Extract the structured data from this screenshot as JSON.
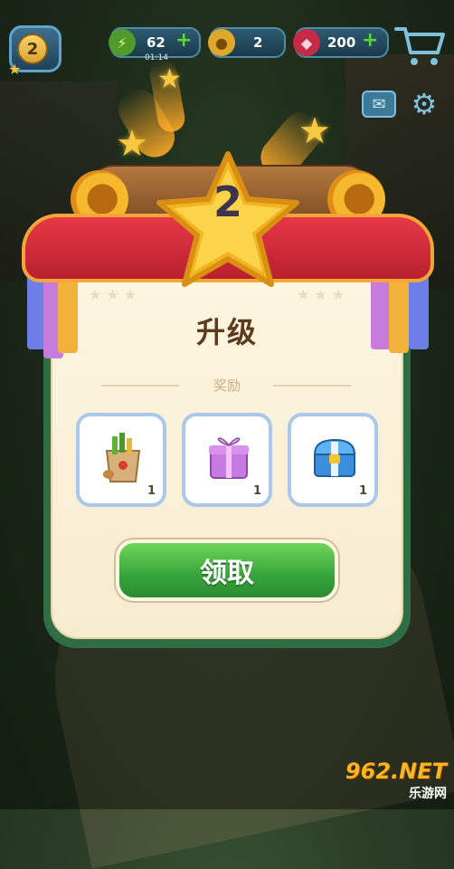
{
  "hud": {
    "level": "2",
    "energy": "62",
    "energy_timer": "01:14",
    "coins": "2",
    "gems": "200",
    "icons": {
      "energy": "lightning-icon",
      "coins": "coin-icon",
      "gems": "ruby-icon",
      "shop": "shopping-cart-icon",
      "mail": "mail-icon",
      "settings": "gear-icon"
    }
  },
  "dialog": {
    "level_number": "2",
    "title": "升级",
    "reward_label": "奖励",
    "rewards": [
      {
        "icon": "grocery-bag-icon",
        "count": "1"
      },
      {
        "icon": "gift-box-icon",
        "count": "1"
      },
      {
        "icon": "treasure-chest-icon",
        "count": "1"
      }
    ],
    "claim_label": "领取"
  },
  "watermark": {
    "text": "962.NET",
    "subtext": "乐游网"
  },
  "colors": {
    "panel_border": "#2f6e45",
    "ribbon": "#d62c3a",
    "claim_button": "#3aa53a",
    "star": "#f7c940"
  }
}
